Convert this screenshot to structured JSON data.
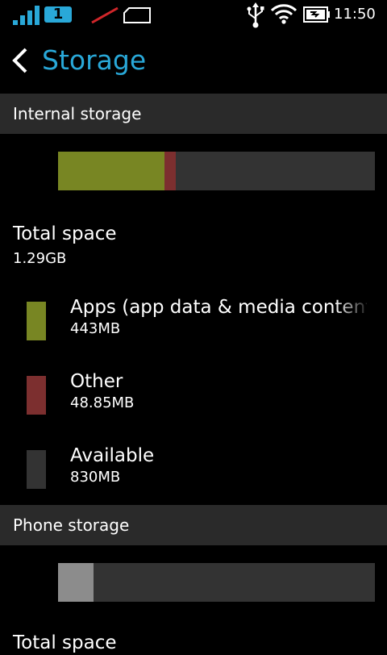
{
  "status_bar": {
    "sim_number": "1",
    "time": "11:50",
    "colors": {
      "accent": "#29a8d8"
    }
  },
  "header": {
    "title": "Storage"
  },
  "internal_storage": {
    "section_title": "Internal storage",
    "total_label": "Total space",
    "total_value": "1.29GB",
    "usage": [
      {
        "key": "apps",
        "fraction": 0.336,
        "color": "#788623"
      },
      {
        "key": "other",
        "fraction": 0.036,
        "color": "#7c2f2f"
      }
    ],
    "legend": [
      {
        "name": "Apps (app data & media content)",
        "size": "443MB",
        "color": "#788623"
      },
      {
        "name": "Other",
        "size": "48.85MB",
        "color": "#7c2f2f"
      },
      {
        "name": "Available",
        "size": "830MB",
        "color": "#333333"
      }
    ]
  },
  "phone_storage": {
    "section_title": "Phone storage",
    "total_label": "Total space",
    "usage": [
      {
        "key": "used",
        "fraction": 0.112,
        "color": "#8c8c8c"
      }
    ]
  }
}
